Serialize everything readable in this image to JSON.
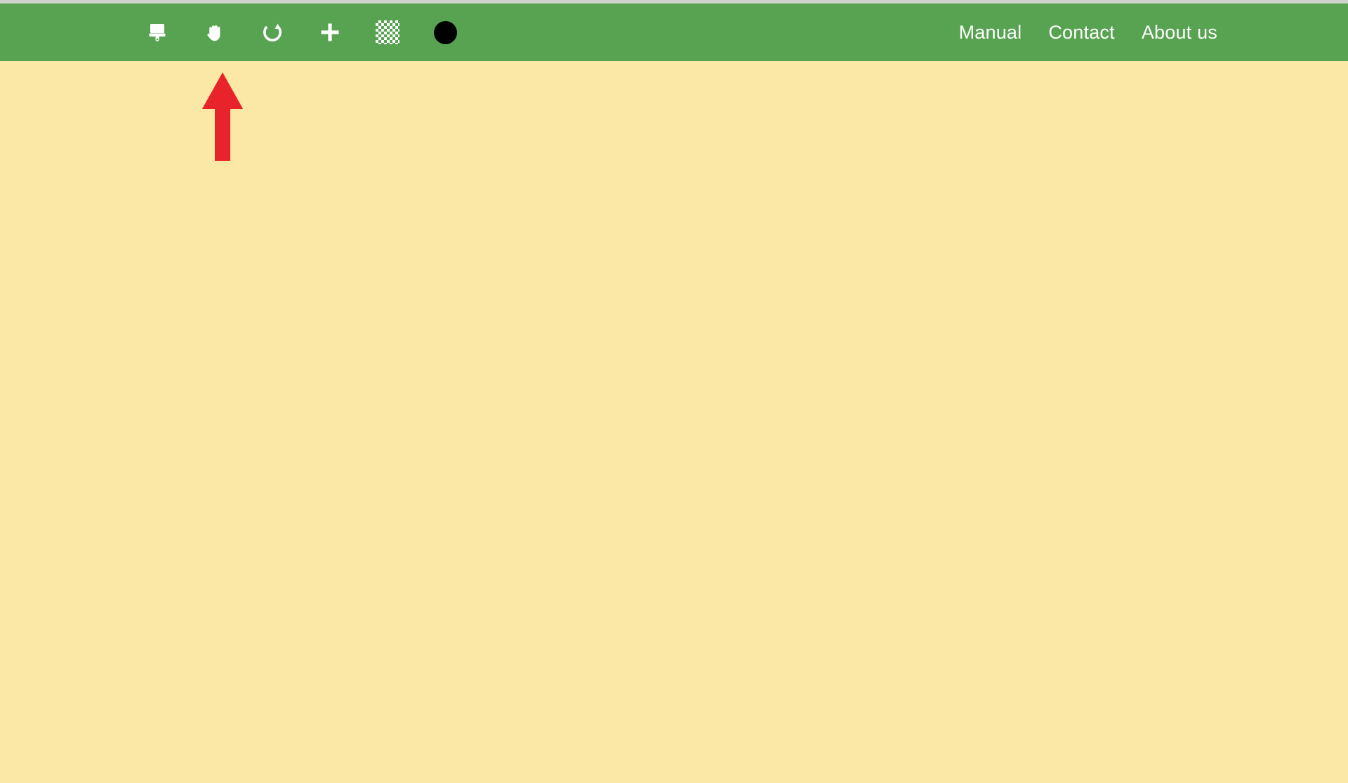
{
  "app": {
    "background_color": "#fbe8a6",
    "toolbar_color": "#58a351",
    "top_strip_color": "#ccd2cc"
  },
  "toolbar": {
    "tools": [
      {
        "name": "paint-brush-tool",
        "icon": "paint-brush-icon",
        "label": "Brush"
      },
      {
        "name": "pan-hand-tool",
        "icon": "hand-icon",
        "label": "Hand"
      },
      {
        "name": "redo-tool",
        "icon": "redo-icon",
        "label": "Redo"
      },
      {
        "name": "add-tool",
        "icon": "plus-icon",
        "label": "Add"
      },
      {
        "name": "transparency-tool",
        "icon": "checkerboard-icon",
        "label": "Transparency"
      },
      {
        "name": "color-swatch-tool",
        "icon": "filled-circle-icon",
        "label": "Color",
        "color": "#000000"
      }
    ],
    "nav_links": [
      {
        "label": "Manual"
      },
      {
        "label": "Contact"
      },
      {
        "label": "About us"
      }
    ]
  },
  "annotation": {
    "arrow": {
      "name": "red-pointer-arrow",
      "color": "#e8232a",
      "direction": "up",
      "points_to": "pan-hand-tool"
    }
  },
  "canvas": {
    "content": ""
  }
}
